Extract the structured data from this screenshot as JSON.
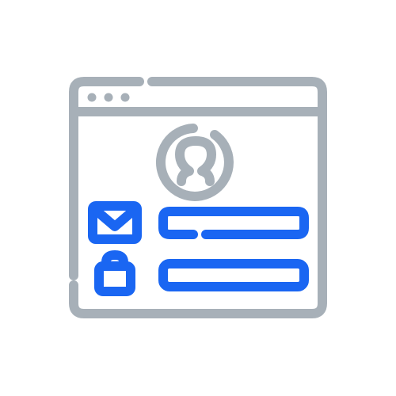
{
  "icon": {
    "name": "login-window-icon",
    "parts": [
      "browser-window-icon",
      "user-avatar-icon",
      "envelope-icon",
      "padlock-icon",
      "email-field",
      "password-field"
    ]
  },
  "colors": {
    "outline": "#A7B0B8",
    "accent": "#1A66F2",
    "background": "#FFFFFF"
  }
}
